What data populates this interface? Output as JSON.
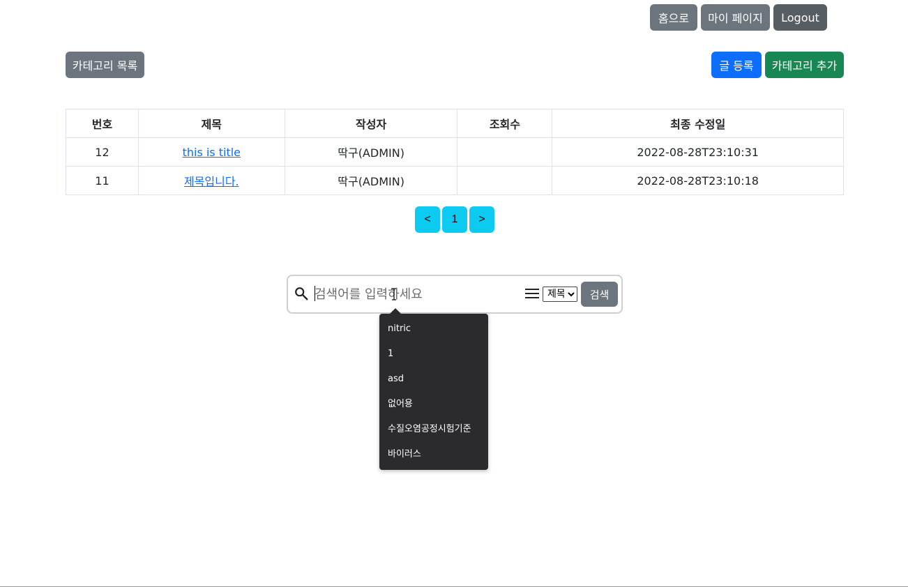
{
  "nav": {
    "home_label": "홈으로",
    "mypage_label": "마이 페이지",
    "logout_label": "Logout"
  },
  "toolbar": {
    "category_list_label": "카테고리 목록",
    "write_label": "글 등록",
    "add_category_label": "카테고리 추가"
  },
  "table": {
    "headers": [
      "번호",
      "제목",
      "작성자",
      "조회수",
      "최종 수정일"
    ],
    "rows": [
      {
        "no": "12",
        "title": "this is title",
        "author": "딱구(ADMIN)",
        "views": "",
        "updated": "2022-08-28T23:10:31"
      },
      {
        "no": "11",
        "title": "제목입니다.",
        "author": "딱구(ADMIN)",
        "views": "",
        "updated": "2022-08-28T23:10:18"
      }
    ]
  },
  "pagination": {
    "prev_label": "<",
    "page_label": "1",
    "next_label": ">"
  },
  "search": {
    "placeholder": "검색어를 입력하세요",
    "value": "",
    "select_selected": "제목",
    "submit_label": "검색",
    "history": [
      "nitric",
      "1",
      "asd",
      "없어용",
      "수질오염공정시험기준",
      "바이러스"
    ]
  },
  "colors": {
    "secondary": "#6c757d",
    "dark": "#565e64",
    "primary": "#0d6efd",
    "success": "#198754",
    "info": "#0dcaf0",
    "tooltip_bg": "#2b2b2d"
  }
}
